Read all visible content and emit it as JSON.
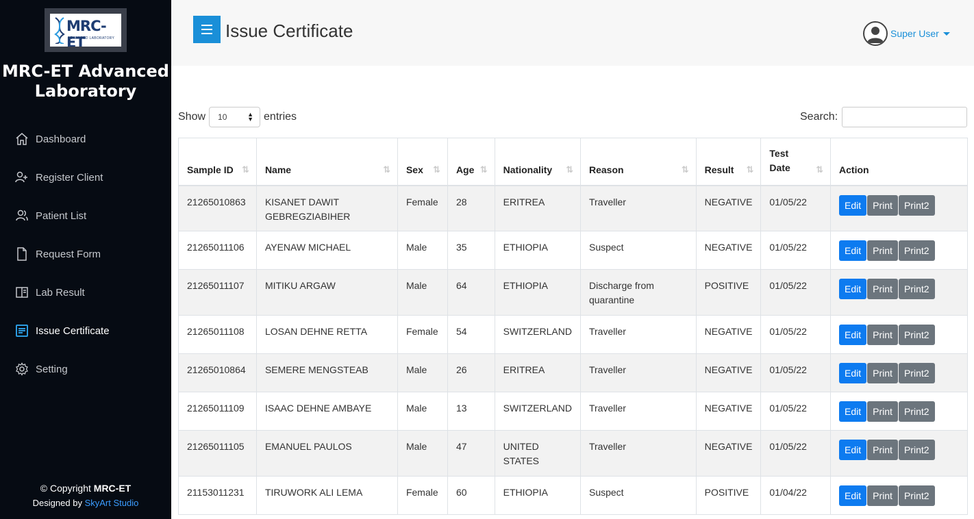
{
  "brand": {
    "logo_text": "MRC-ET",
    "logo_sub": "ADVANCED LABORATORY",
    "title": "MRC-ET Advanced Laboratory"
  },
  "sidebar": {
    "items": [
      {
        "label": "Dashboard",
        "icon": "home-icon"
      },
      {
        "label": "Register Client",
        "icon": "user-plus-icon"
      },
      {
        "label": "Patient List",
        "icon": "users-icon"
      },
      {
        "label": "Request Form",
        "icon": "file-icon"
      },
      {
        "label": "Lab Result",
        "icon": "book-icon"
      },
      {
        "label": "Issue Certificate",
        "icon": "document-list-icon"
      },
      {
        "label": "Setting",
        "icon": "gear-icon"
      }
    ],
    "active_index": 5
  },
  "footer": {
    "copyright_prefix": "© Copyright ",
    "copyright_brand": "MRC-ET",
    "designed_prefix": "Designed by ",
    "designed_link": "SkyArt Studio"
  },
  "header": {
    "title": "Issue Certificate",
    "user_name": "Super User"
  },
  "controls": {
    "show_label": "Show",
    "entries_value": "10",
    "entries_label": "entries",
    "search_label": "Search:",
    "search_value": ""
  },
  "table": {
    "columns": [
      "Sample ID",
      "Name",
      "Sex",
      "Age",
      "Nationality",
      "Reason",
      "Result",
      "Test Date",
      "Action"
    ],
    "actions": [
      "Edit",
      "Print",
      "Print2"
    ],
    "rows": [
      {
        "id": "21265010863",
        "name": "KISANET DAWIT GEBREGZIABIHER",
        "sex": "Female",
        "age": "28",
        "nationality": "ERITREA",
        "reason": "Traveller",
        "result": "NEGATIVE",
        "date": "01/05/22"
      },
      {
        "id": "21265011106",
        "name": "AYENAW MICHAEL",
        "sex": "Male",
        "age": "35",
        "nationality": "ETHIOPIA",
        "reason": "Suspect",
        "result": "NEGATIVE",
        "date": "01/05/22"
      },
      {
        "id": "21265011107",
        "name": "MITIKU ARGAW",
        "sex": "Male",
        "age": "64",
        "nationality": "ETHIOPIA",
        "reason": "Discharge from quarantine",
        "result": "POSITIVE",
        "date": "01/05/22"
      },
      {
        "id": "21265011108",
        "name": "LOSAN DEHNE RETTA",
        "sex": "Female",
        "age": "54",
        "nationality": "SWITZERLAND",
        "reason": "Traveller",
        "result": "NEGATIVE",
        "date": "01/05/22"
      },
      {
        "id": "21265010864",
        "name": "SEMERE MENGSTEAB",
        "sex": "Male",
        "age": "26",
        "nationality": "ERITREA",
        "reason": "Traveller",
        "result": "NEGATIVE",
        "date": "01/05/22"
      },
      {
        "id": "21265011109",
        "name": "ISAAC DEHNE AMBAYE",
        "sex": "Male",
        "age": "13",
        "nationality": "SWITZERLAND",
        "reason": "Traveller",
        "result": "NEGATIVE",
        "date": "01/05/22"
      },
      {
        "id": "21265011105",
        "name": "EMANUEL PAULOS",
        "sex": "Male",
        "age": "47",
        "nationality": "UNITED STATES",
        "reason": "Traveller",
        "result": "NEGATIVE",
        "date": "01/05/22"
      },
      {
        "id": "21153011231",
        "name": "TIRUWORK ALI LEMA",
        "sex": "Female",
        "age": "60",
        "nationality": "ETHIOPIA",
        "reason": "Suspect",
        "result": "POSITIVE",
        "date": "01/04/22"
      }
    ]
  }
}
